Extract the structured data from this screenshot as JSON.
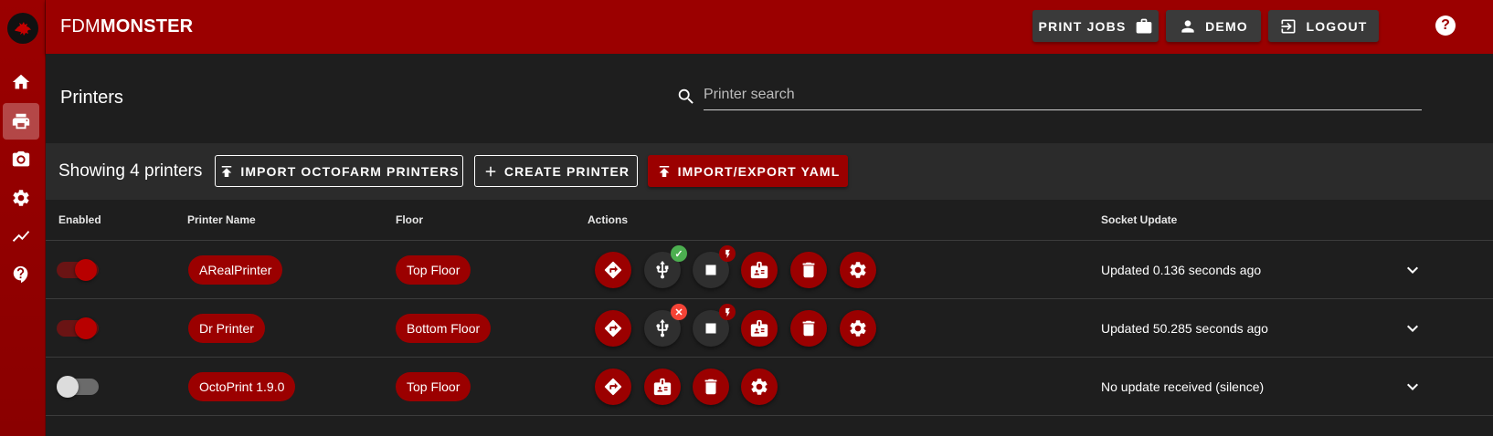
{
  "app": {
    "brand_prefix": "FDM",
    "brand_suffix": "MONSTER"
  },
  "topbar": {
    "print_jobs_label": "PRINT JOBS",
    "user_label": "DEMO",
    "logout_label": "LOGOUT",
    "help_glyph": "?"
  },
  "nav": {
    "items": [
      {
        "icon": "home-icon",
        "active": false
      },
      {
        "icon": "printer-icon",
        "active": true
      },
      {
        "icon": "camera-icon",
        "active": false
      },
      {
        "icon": "gear-icon",
        "active": false
      },
      {
        "icon": "chart-line-icon",
        "active": false
      },
      {
        "icon": "help-bubble-icon",
        "active": false
      }
    ]
  },
  "header": {
    "title": "Printers",
    "search_placeholder": "Printer search",
    "search_value": ""
  },
  "toolbar": {
    "showing_text": "Showing 4 printers",
    "import_octofarm_label": "IMPORT OCTOFARM PRINTERS",
    "create_printer_label": "CREATE PRINTER",
    "import_export_yaml_label": "IMPORT/EXPORT YAML"
  },
  "table": {
    "headers": {
      "enabled": "Enabled",
      "name": "Printer Name",
      "floor": "Floor",
      "actions": "Actions",
      "socket": "Socket Update"
    },
    "rows": [
      {
        "enabled": true,
        "name": "ARealPrinter",
        "floor": "Top Floor",
        "usb_status": "connected",
        "socket_update": "Updated 0.136 seconds ago"
      },
      {
        "enabled": true,
        "name": "Dr Printer",
        "floor": "Bottom Floor",
        "usb_status": "disconnected",
        "socket_update": "Updated 50.285 seconds ago"
      },
      {
        "enabled": false,
        "name": "OctoPrint 1.9.0",
        "floor": "Top Floor",
        "usb_status": null,
        "socket_update": "No update received (silence)"
      }
    ]
  },
  "colors": {
    "brand_red": "#9b0000",
    "background": "#1e1e1e",
    "success_green": "#4caf50",
    "error_red": "#f44336"
  }
}
